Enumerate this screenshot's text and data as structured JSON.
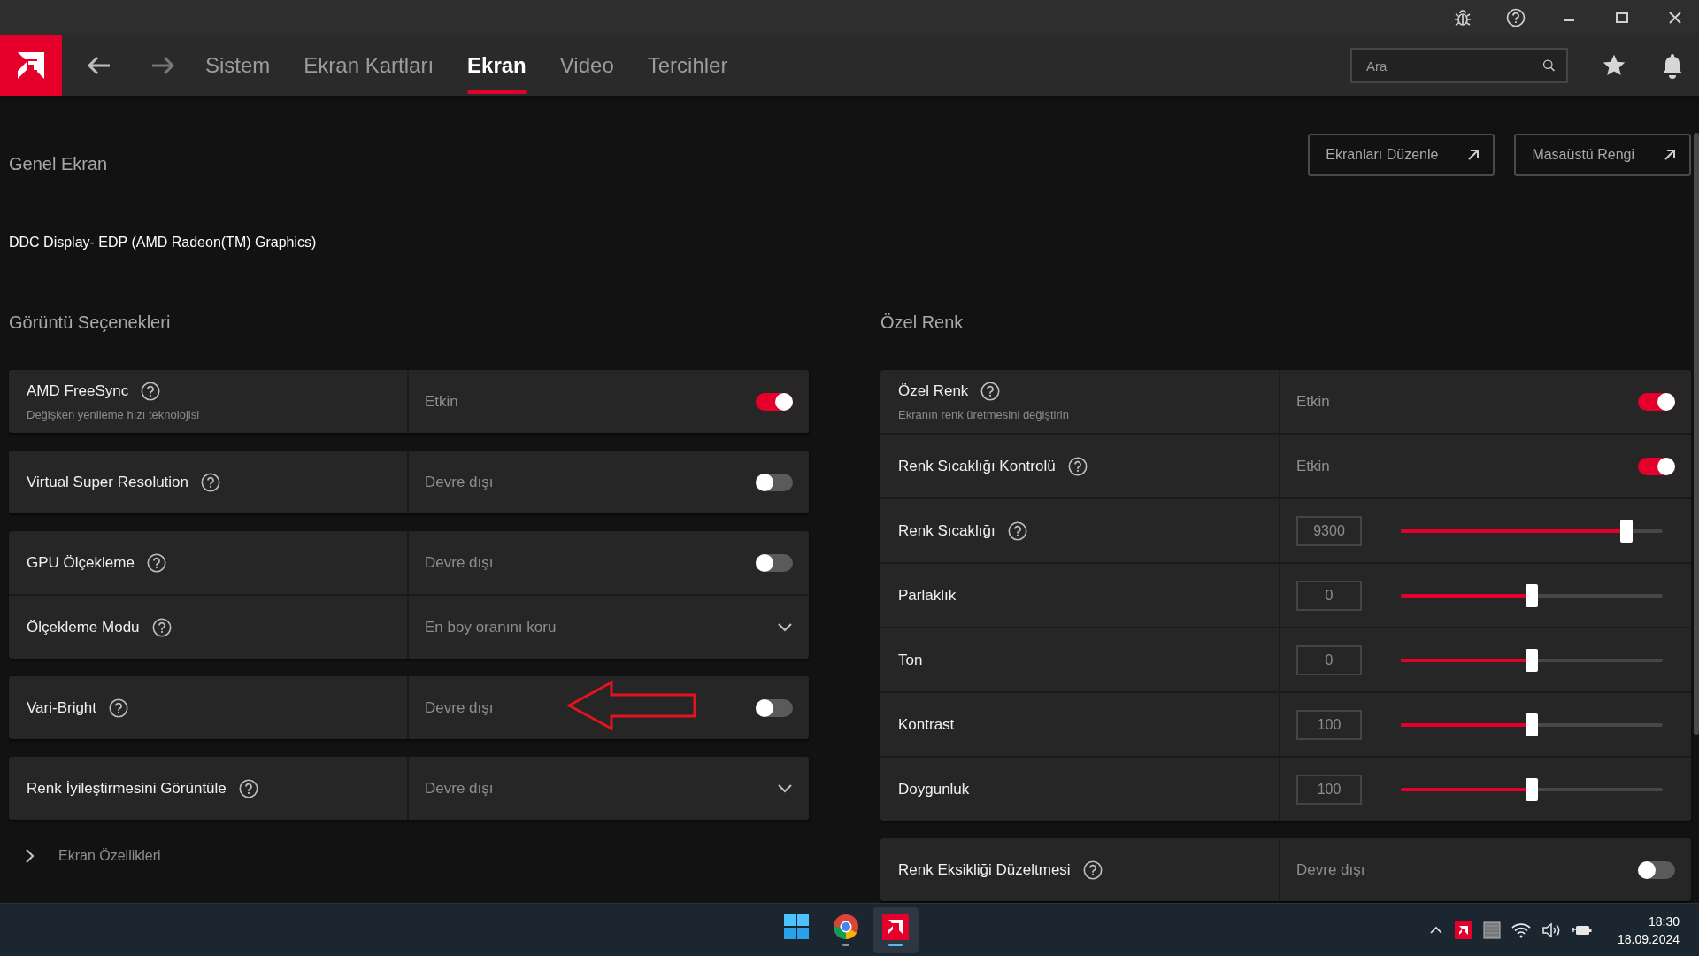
{
  "nav": {
    "tabs": [
      {
        "label": "Sistem",
        "selected": false
      },
      {
        "label": "Ekran Kartları",
        "selected": false
      },
      {
        "label": "Ekran",
        "selected": true
      },
      {
        "label": "Video",
        "selected": false
      },
      {
        "label": "Tercihler",
        "selected": false
      }
    ],
    "search": {
      "placeholder": "Ara"
    }
  },
  "page": {
    "title": "Genel Ekran",
    "buttons": [
      "Ekranları Düzenle",
      "Masaüstü Rengi"
    ],
    "display": "DDC Display- EDP (AMD Radeon(TM) Graphics)"
  },
  "sections": [
    {
      "title": "Görüntü Seçenekleri",
      "groups": [
        [
          {
            "kind": "toggle",
            "label": "AMD FreeSync",
            "help": true,
            "subtitle": "Değişken yenileme hızı teknolojisi",
            "value": "Etkin",
            "on": true
          }
        ],
        [
          {
            "kind": "toggle",
            "label": "Virtual Super Resolution",
            "help": true,
            "value": "Devre dışı",
            "on": false
          }
        ],
        [
          {
            "kind": "toggle",
            "label": "GPU Ölçekleme",
            "help": true,
            "value": "Devre dışı",
            "on": false
          },
          {
            "kind": "dropdown",
            "label": "Ölçekleme Modu",
            "help": true,
            "value": "En boy oranını koru"
          }
        ],
        [
          {
            "kind": "toggle",
            "label": "Vari-Bright",
            "help": true,
            "value": "Devre dışı",
            "on": false,
            "annotated": true
          }
        ],
        [
          {
            "kind": "dropdown",
            "label": "Renk İyileştirmesini Görüntüle",
            "help": true,
            "value": "Devre dışı"
          }
        ]
      ],
      "expander": {
        "label": "Ekran Özellikleri",
        "expanded": false
      }
    },
    {
      "title": "Özel Renk",
      "groups": [
        [
          {
            "kind": "toggle",
            "label": "Özel Renk",
            "help": true,
            "subtitle": "Ekranın renk üretmesini değiştirin",
            "value": "Etkin",
            "on": true
          },
          {
            "kind": "toggle",
            "label": "Renk Sıcaklığı Kontrolü",
            "help": true,
            "value": "Etkin",
            "on": true
          },
          {
            "kind": "slider",
            "label": "Renk Sıcaklığı",
            "help": true,
            "value": "9300",
            "level": 0.86
          },
          {
            "kind": "slider",
            "label": "Parlaklık",
            "help": false,
            "value": "0",
            "level": 0.5
          },
          {
            "kind": "slider",
            "label": "Ton",
            "help": false,
            "value": "0",
            "level": 0.5
          },
          {
            "kind": "slider",
            "label": "Kontrast",
            "help": false,
            "value": "100",
            "level": 0.5
          },
          {
            "kind": "slider",
            "label": "Doygunluk",
            "help": false,
            "value": "100",
            "level": 0.5
          }
        ],
        [
          {
            "kind": "toggle",
            "label": "Renk Eksikliği Düzeltmesi",
            "help": true,
            "value": "Devre dışı",
            "on": false
          }
        ]
      ]
    }
  ],
  "taskbar": {
    "apps": [
      {
        "kind": "start",
        "running": false,
        "active": false
      },
      {
        "kind": "browser",
        "running": true,
        "active": false
      },
      {
        "kind": "amd",
        "running": true,
        "active": true
      }
    ],
    "clock": {
      "time": "18:30",
      "date": "18.09.2024"
    }
  }
}
